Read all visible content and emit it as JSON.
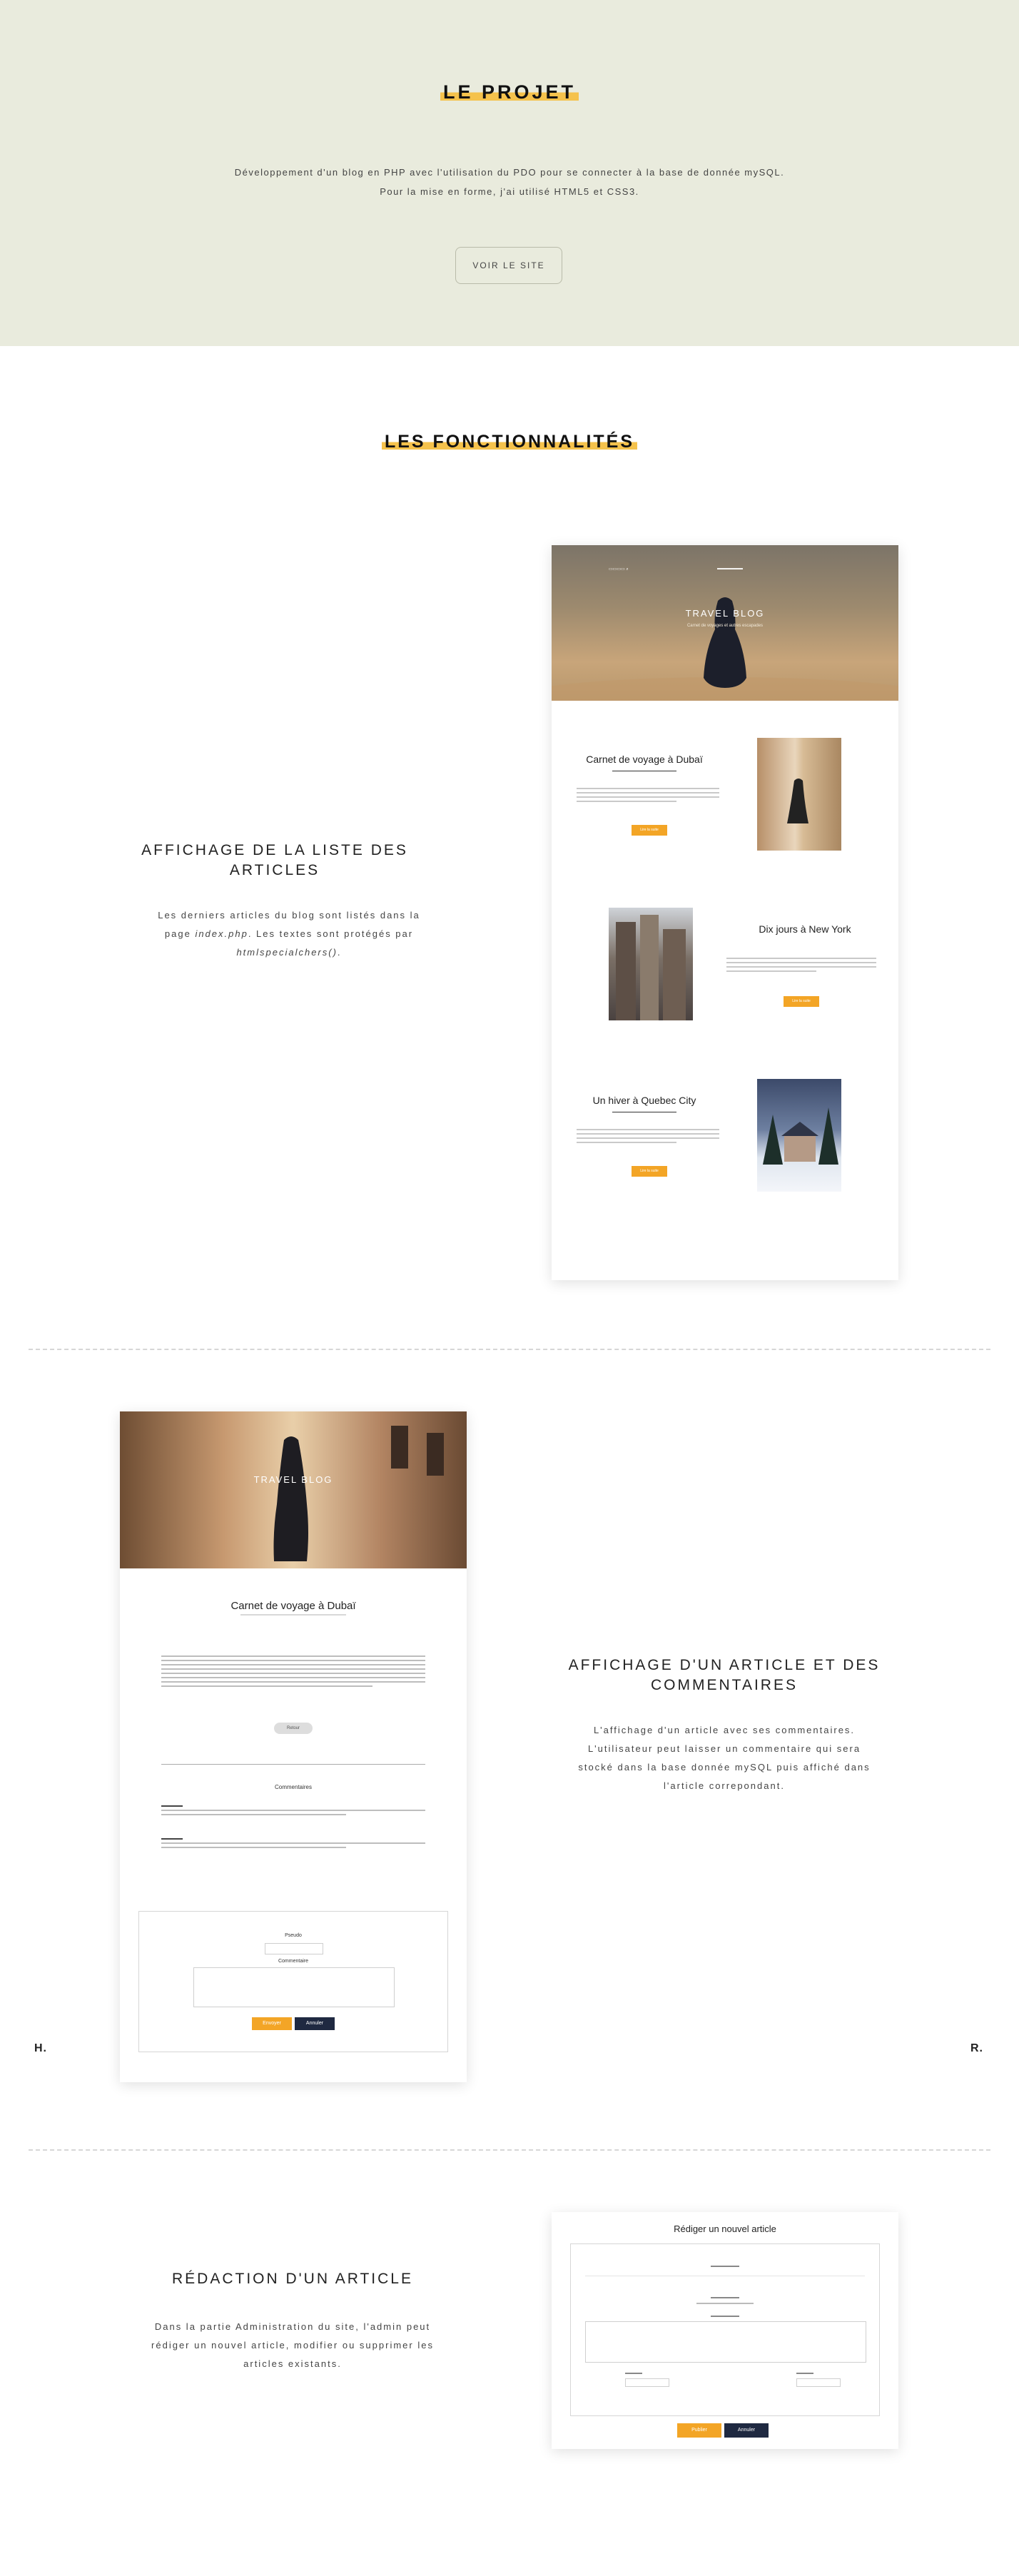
{
  "projet": {
    "title": "LE PROJET",
    "desc_line1": "Développement d'un blog en PHP avec l'utilisation du PDO pour se connecter à la base de donnée mySQL.",
    "desc_line2": "Pour la mise en forme, j'ai utilisé HTML5 et CSS3.",
    "button": "VOIR LE SITE",
    "bg_color": "#e9ebdd",
    "highlight_color": "#f5c24c"
  },
  "fonctionnalites": {
    "title": "LES FONCTIONNALITÉS",
    "features": [
      {
        "title": "AFFICHAGE DE LA LISTE DES ARTICLES",
        "desc_pre": "Les derniers articles du blog sont listés dans la page ",
        "desc_code1": "index.php",
        "desc_mid": ". Les textes sont protégés par ",
        "desc_code2": "htmlspecialchers()",
        "desc_post": "."
      },
      {
        "title": "AFFICHAGE D'UN ARTICLE ET DES COMMENTAIRES",
        "desc": "L'affichage d'un article avec ses commentaires. L'utilisateur peut laisser un commentaire qui sera stocké dans la base donnée mySQL puis affiché dans l'article correpondant."
      },
      {
        "title": "RÉDACTION D'UN ARTICLE",
        "desc": "Dans la partie Administration du site, l'admin peut rédiger un nouvel article, modifier ou supprimer les articles existants."
      }
    ]
  },
  "mock_blog_list": {
    "hero_title": "TRAVEL BLOG",
    "hero_sub": "Carnet de voyages et autres escapades",
    "articles": [
      {
        "title": "Carnet de voyage à Dubaï",
        "button": "Lire la suite"
      },
      {
        "title": "Dix jours à New York",
        "button": "Lire la suite"
      },
      {
        "title": "Un hiver à Quebec City",
        "button": "Lire la suite"
      }
    ],
    "accent_color": "#f3a526"
  },
  "mock_article": {
    "hero_title": "TRAVEL BLOG",
    "title": "Carnet de voyage à Dubaï",
    "back_button": "Retour",
    "comments_heading": "Commentaires",
    "form_label_pseudo": "Pseudo",
    "form_label_comment": "Commentaire",
    "btn_send": "Envoyer",
    "btn_cancel": "Annuler"
  },
  "mock_redaction": {
    "title": "Rédiger un nouvel article",
    "btn_publish": "Publier",
    "btn_cancel": "Annuler"
  },
  "side_marks": {
    "left": "H.",
    "right": "R."
  }
}
